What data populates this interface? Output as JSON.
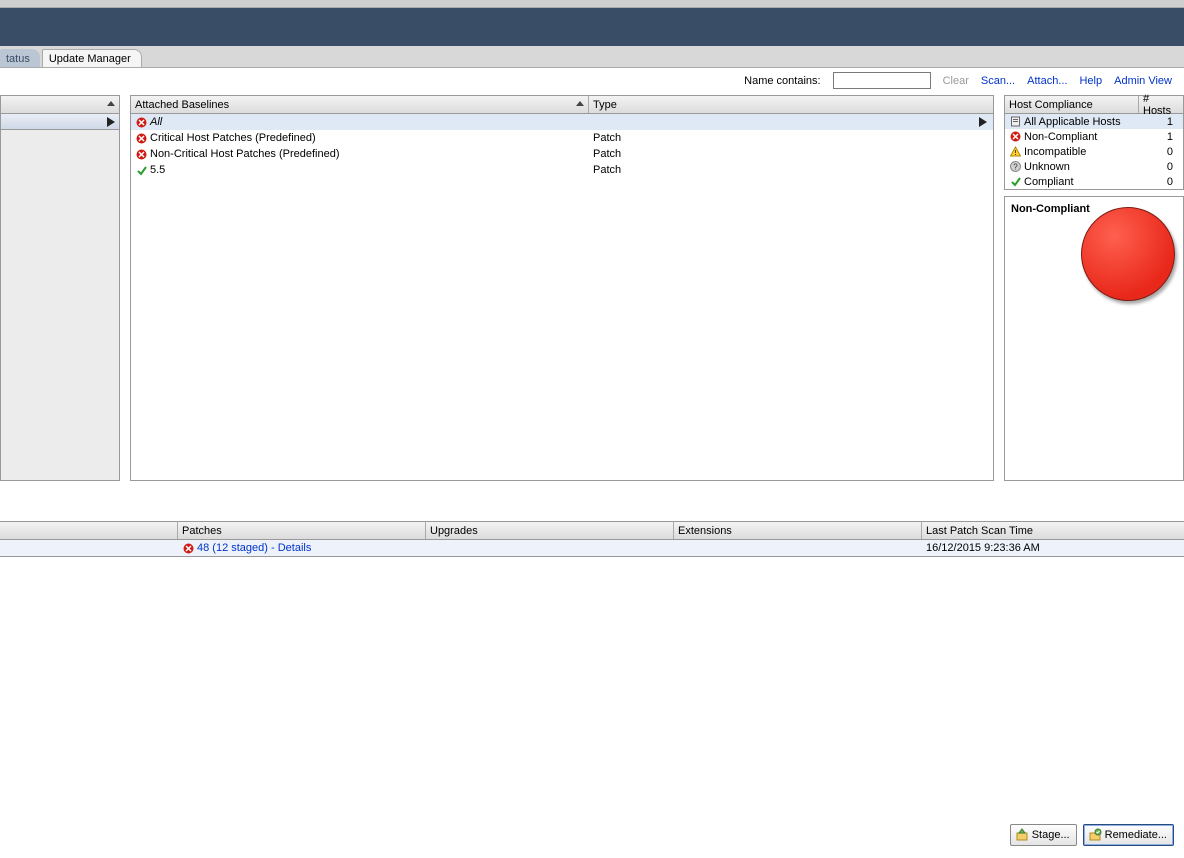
{
  "tabs": {
    "inactive": "tatus",
    "active": "Update Manager"
  },
  "toolbar": {
    "name_contains": "Name contains:",
    "filter_value": "",
    "clear": "Clear",
    "scan": "Scan...",
    "attach": "Attach...",
    "help": "Help",
    "admin_view": "Admin View"
  },
  "baselines": {
    "header_name": "Attached Baselines",
    "header_type": "Type",
    "rows": [
      {
        "icon": "red-x",
        "name": "All",
        "type": "",
        "sel": true
      },
      {
        "icon": "red-x",
        "name": "Critical Host Patches (Predefined)",
        "type": "Patch"
      },
      {
        "icon": "red-x",
        "name": "Non-Critical Host Patches (Predefined)",
        "type": "Patch"
      },
      {
        "icon": "check",
        "name": "5.5",
        "type": "Patch"
      }
    ]
  },
  "host_compliance": {
    "header_label": "Host Compliance",
    "header_count": "# Hosts",
    "rows": [
      {
        "icon": "host",
        "label": "All Applicable Hosts",
        "count": "1",
        "sel": true
      },
      {
        "icon": "red-x",
        "label": "Non-Compliant",
        "count": "1"
      },
      {
        "icon": "warn",
        "label": "Incompatible",
        "count": "0"
      },
      {
        "icon": "q",
        "label": "Unknown",
        "count": "0"
      },
      {
        "icon": "check",
        "label": "Compliant",
        "count": "0"
      }
    ],
    "chart_label": "Non-Compliant"
  },
  "bottom": {
    "headers": {
      "c1": "",
      "c2": "Patches",
      "c3": "Upgrades",
      "c4": "Extensions",
      "c5": "Last Patch Scan Time"
    },
    "row": {
      "patches_text": "48 (12 staged) - Details",
      "scan_time": "16/12/2015 9:23:36 AM"
    }
  },
  "buttons": {
    "stage": "Stage...",
    "remediate": "Remediate..."
  },
  "chart_data": {
    "type": "pie",
    "title": "Non-Compliant",
    "series": [
      {
        "name": "Non-Compliant",
        "value": 1,
        "color": "#e8281a"
      },
      {
        "name": "Incompatible",
        "value": 0,
        "color": "#f0b400"
      },
      {
        "name": "Unknown",
        "value": 0,
        "color": "#888888"
      },
      {
        "name": "Compliant",
        "value": 0,
        "color": "#2a9d2a"
      }
    ]
  }
}
